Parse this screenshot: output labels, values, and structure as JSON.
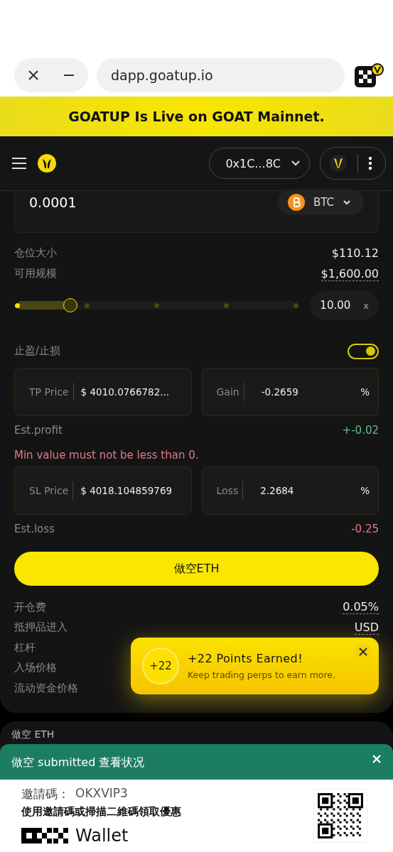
{
  "browser": {
    "url": "dapp.goatup.io"
  },
  "banner": {
    "text": "GOATUP Is Live on GOAT Mainnet."
  },
  "header": {
    "address": "0x1C...8C"
  },
  "amount": {
    "value": "0.0001",
    "token": "BTC"
  },
  "summary": [
    {
      "label": "仓位大小",
      "value": "$110.12",
      "dotted": false
    },
    {
      "label": "可用规模",
      "value": "$1,600.00",
      "dotted": true
    }
  ],
  "leverage": {
    "level": 0.19,
    "value": "10.00",
    "unit": "x"
  },
  "tpsl": {
    "label": "止盈/止损",
    "on": true
  },
  "tp": {
    "price_label": "TP Price",
    "currency": "$",
    "price": "4010.0766782...",
    "pct_label": "Gain",
    "pct": "-0.2659",
    "unit": "%",
    "est_label": "Est.profit",
    "est": "+-0.02",
    "color": "#5fc08e"
  },
  "error": "Min value must not be less than 0.",
  "sl": {
    "price_label": "SL Price",
    "currency": "$",
    "price": "4018.104859769",
    "pct_label": "Loss",
    "pct": "2.2684",
    "unit": "%",
    "est_label": "Est.loss",
    "est": "-0.25",
    "color": "#e07a8a"
  },
  "submit": "做空ETH",
  "details": [
    {
      "label": "开仓费",
      "value": "0.05%"
    },
    {
      "label": "抵押品进入",
      "value": "USD"
    },
    {
      "label": "杠杆"
    },
    {
      "label": "入场价格"
    },
    {
      "label": "流动资金价格"
    }
  ],
  "points_toast": {
    "badge": "+22",
    "title": "+22 Points Earned!",
    "message": "Keep trading perps to earn more."
  },
  "position_card": {
    "title": "做空 ETH"
  },
  "submitted_toast": {
    "text": "做空 submitted  查看状况"
  },
  "ad": {
    "code_label": "邀請碼：",
    "code": "OKXVIP3",
    "message": "使用邀請碼或掃描二維碼領取優惠",
    "brand": "Wallet"
  }
}
